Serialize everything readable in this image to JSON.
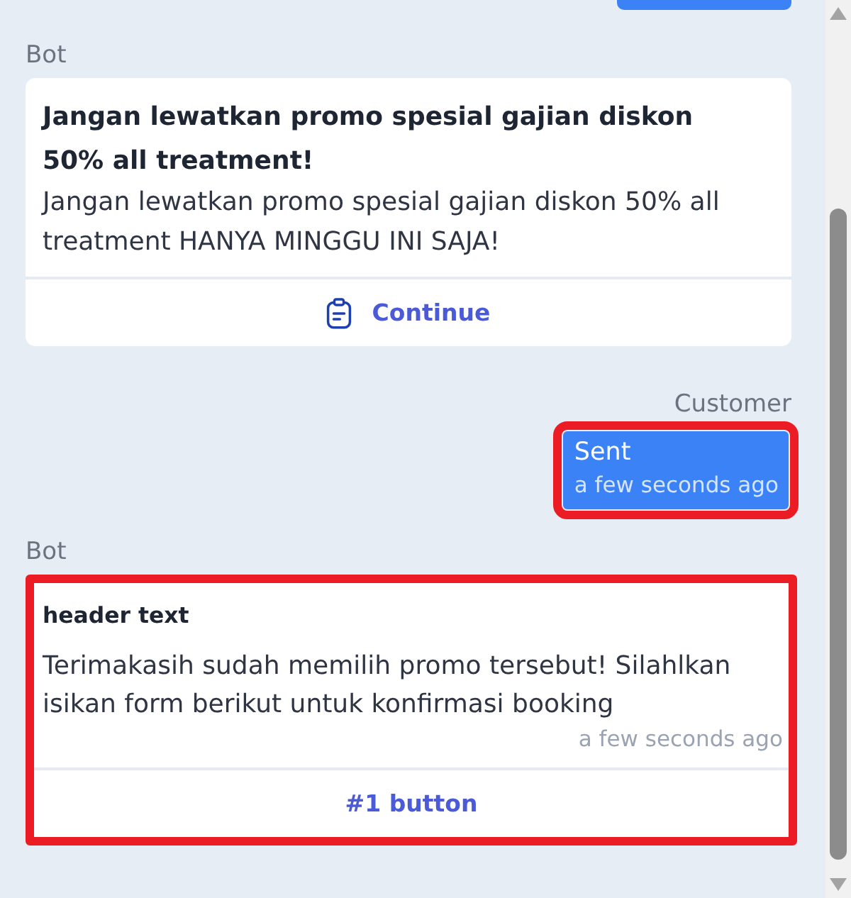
{
  "messages": [
    {
      "kind": "clipped_bubble"
    },
    {
      "kind": "bot_card",
      "sender": "Bot",
      "title": "Jangan lewatkan promo spesial gajian diskon 50% all treatment!",
      "body": "Jangan lewatkan promo spesial gajian diskon 50% all treatment HANYA MINGGU INI SAJA!",
      "highlighted": false,
      "actions": [
        {
          "kind": "form",
          "label": "Continue"
        }
      ]
    },
    {
      "kind": "customer_bubble",
      "sender": "Customer",
      "text": "Sent",
      "time": "a few seconds ago",
      "highlighted": true
    },
    {
      "kind": "bot_card",
      "sender": "Bot",
      "header": "header text",
      "body": "Terimakasih sudah memilih promo tersebut! Silahlkan isikan form berikut untuk konfirmasi booking",
      "time": "a few seconds ago",
      "highlighted": true,
      "actions": [
        {
          "kind": "plain",
          "label": "#1 button"
        }
      ]
    }
  ]
}
